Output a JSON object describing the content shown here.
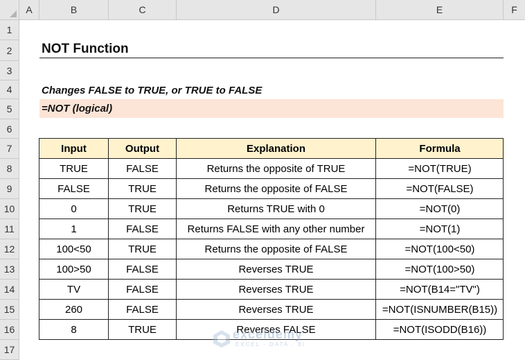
{
  "columns": [
    "A",
    "B",
    "C",
    "D",
    "E",
    "F"
  ],
  "rows": [
    "1",
    "2",
    "3",
    "4",
    "5",
    "6",
    "7",
    "8",
    "9",
    "10",
    "11",
    "12",
    "13",
    "14",
    "15",
    "16",
    "17"
  ],
  "title": "NOT Function",
  "description": "Changes FALSE to TRUE, or TRUE to FALSE",
  "syntax": "=NOT (logical)",
  "table": {
    "headers": [
      "Input",
      "Output",
      "Explanation",
      "Formula"
    ],
    "rows": [
      [
        "TRUE",
        "FALSE",
        "Returns the opposite of TRUE",
        "=NOT(TRUE)"
      ],
      [
        "FALSE",
        "TRUE",
        "Returns the opposite of FALSE",
        "=NOT(FALSE)"
      ],
      [
        "0",
        "TRUE",
        "Returns TRUE with 0",
        "=NOT(0)"
      ],
      [
        "1",
        "FALSE",
        "Returns FALSE with any other number",
        "=NOT(1)"
      ],
      [
        "100<50",
        "TRUE",
        "Returns the opposite of FALSE",
        "=NOT(100<50)"
      ],
      [
        "100>50",
        "FALSE",
        "Reverses TRUE",
        "=NOT(100>50)"
      ],
      [
        "TV",
        "FALSE",
        "Reverses TRUE",
        "=NOT(B14=\"TV\")"
      ],
      [
        "260",
        "FALSE",
        "Reverses TRUE",
        "=NOT(ISNUMBER(B15))"
      ],
      [
        "8",
        "TRUE",
        "Reverses FALSE",
        "=NOT(ISODD(B16))"
      ]
    ]
  },
  "watermark": {
    "name": "exceldemy",
    "tagline": "EXCEL · DATA · BI"
  },
  "colors": {
    "header_fill": "#fff2cc",
    "syntax_fill": "#fce4d6",
    "grid_header": "#e6e6e6"
  }
}
